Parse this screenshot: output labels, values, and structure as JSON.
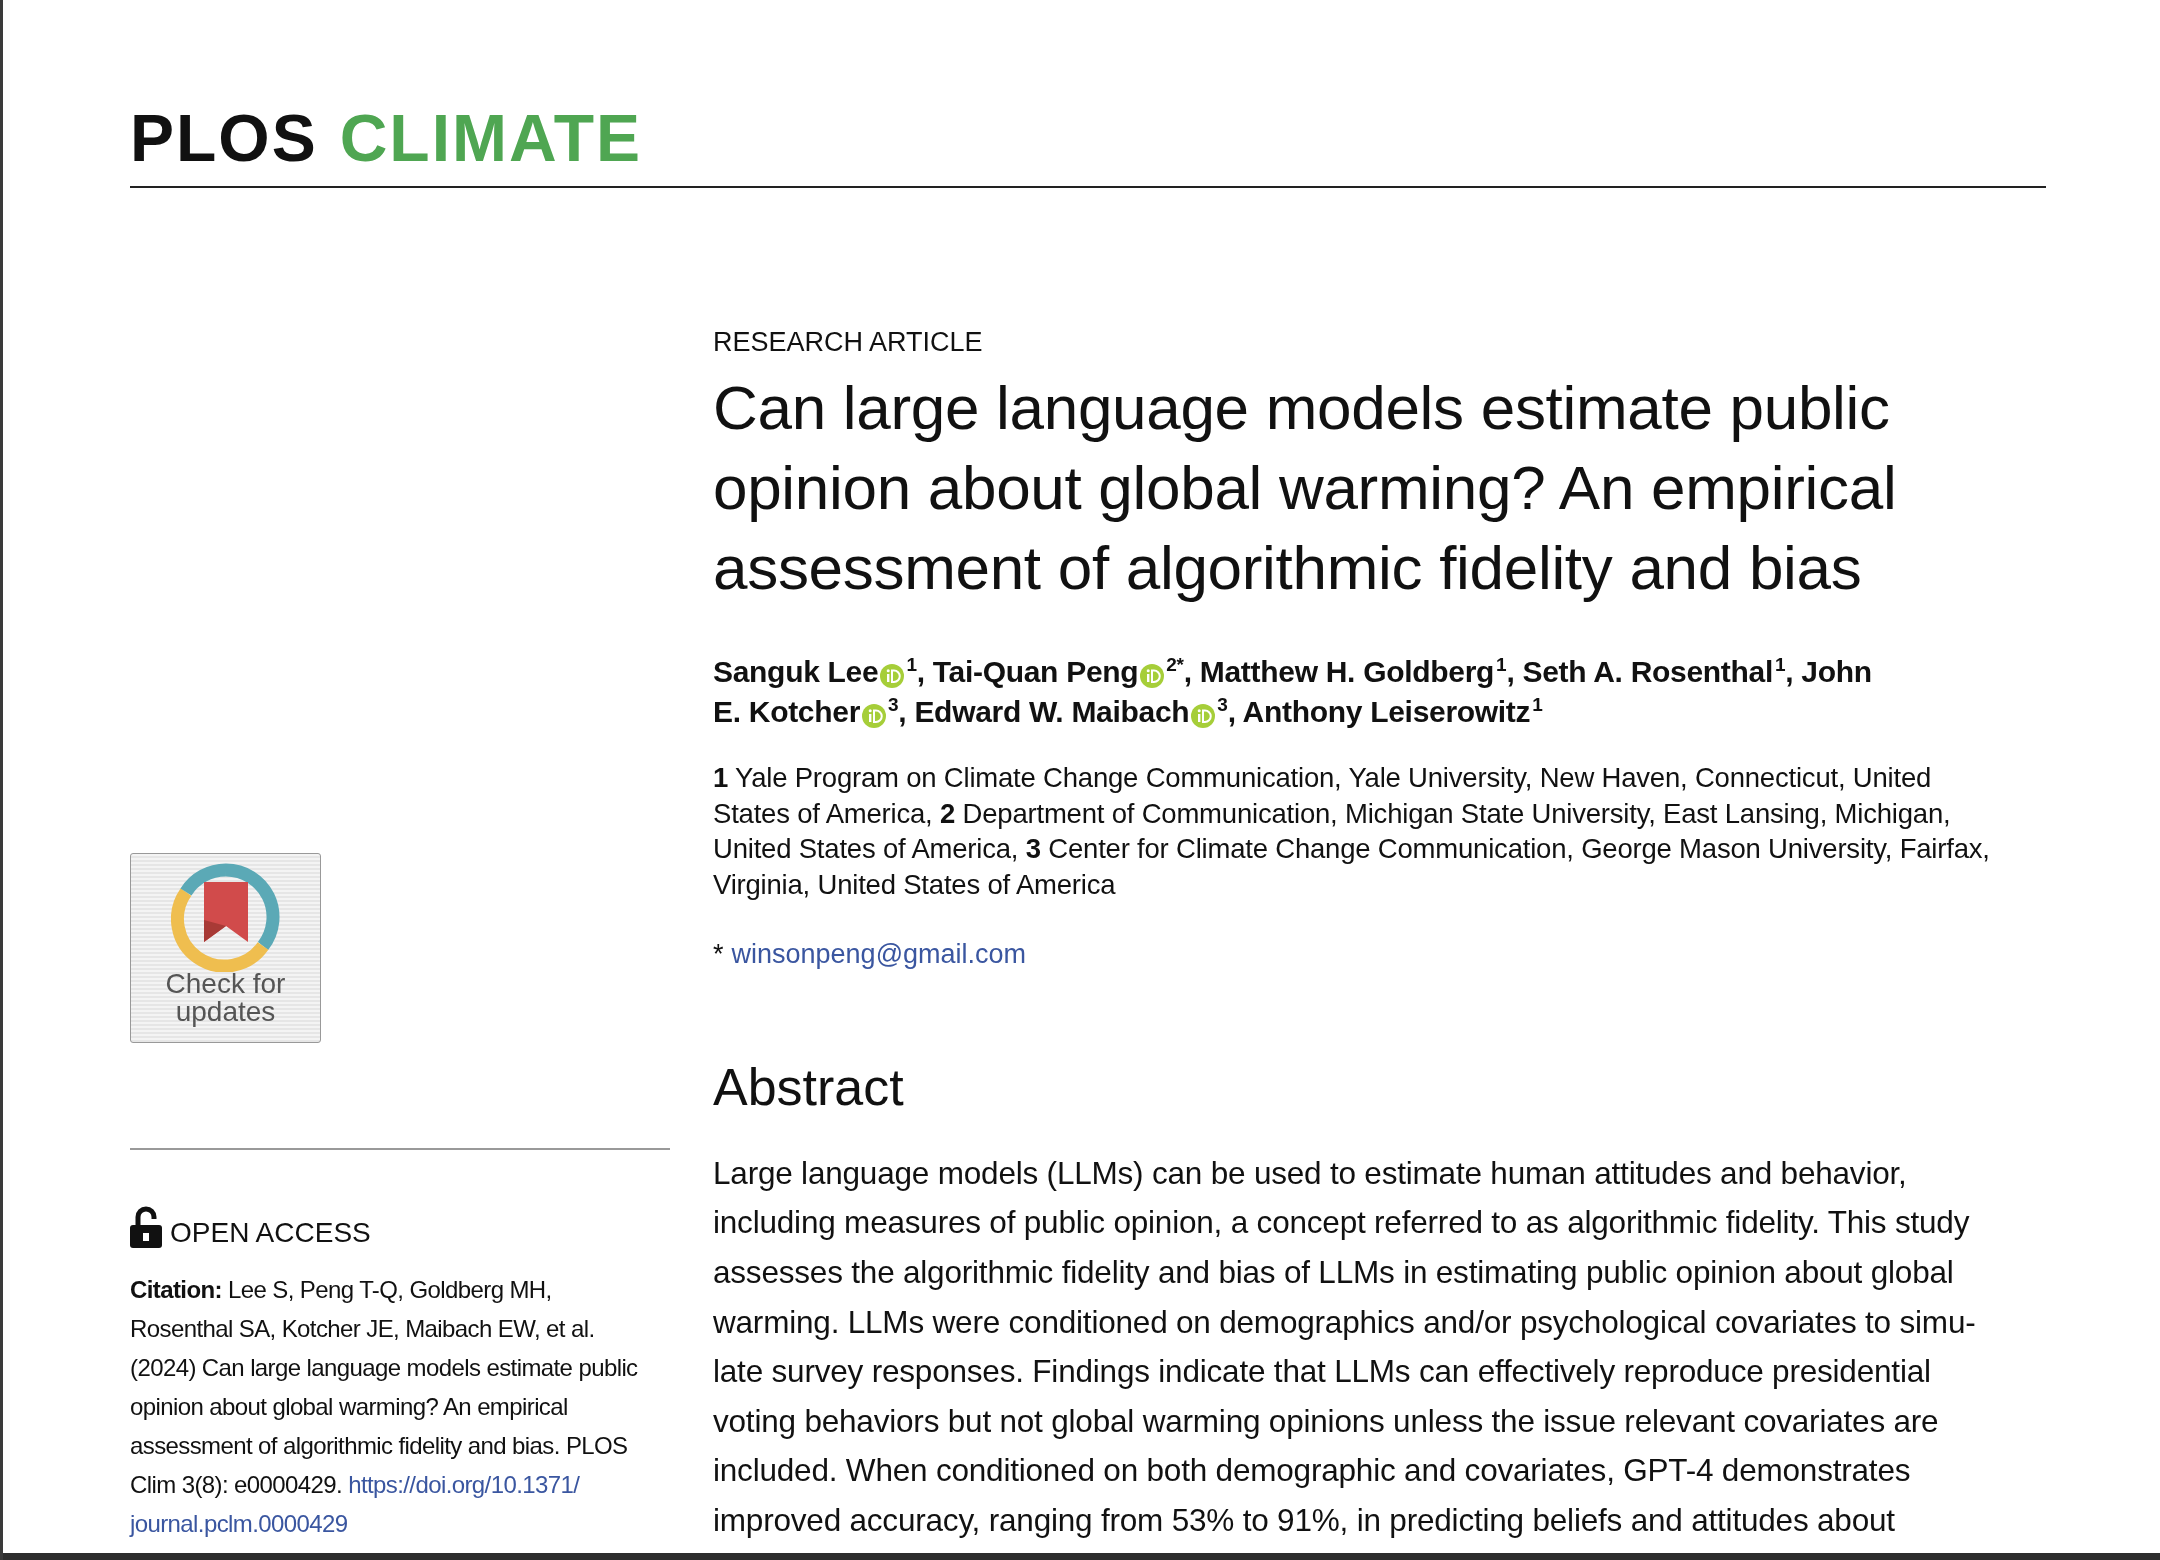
{
  "logo": {
    "parts": [
      {
        "text": "PLOS",
        "color": "#111111"
      },
      {
        "text": "CLIMATE",
        "color": "#4fa652"
      }
    ]
  },
  "sidebar": {
    "badge": {
      "label_lines": [
        "Check for",
        "updates"
      ]
    },
    "access": {
      "label": "OPEN ACCESS"
    },
    "citation": {
      "label": "Citation:",
      "text_lines": [
        " Lee S, Peng T-Q, Goldberg MH,",
        "Rosenthal SA, Kotcher JE, Maibach EW, et al.",
        "(2024) Can large language models estimate public",
        "opinion about global warming? An empirical",
        "assessment of algorithmic fidelity and bias. PLOS",
        "Clim 3(8): e0000429. "
      ],
      "link_lines": [
        "https://doi.org/10.1371/",
        "journal.pclm.0000429"
      ]
    }
  },
  "article": {
    "type": "RESEARCH ARTICLE",
    "title_lines": [
      "Can large language models estimate public",
      "opinion about global warming? An empirical",
      "assessment of algorithmic fidelity and bias"
    ],
    "authors": [
      {
        "name_lines": [
          "Sanguk Lee"
        ],
        "orcid": true,
        "refs": "1",
        "sep": ","
      },
      {
        "name_lines": [
          "Tai-Quan Peng"
        ],
        "orcid": true,
        "refs": "2*",
        "sep": ","
      },
      {
        "name_lines": [
          "Matthew H. Goldberg"
        ],
        "orcid": false,
        "refs": "1",
        "sep": ","
      },
      {
        "name_lines": [
          "Seth A. Rosenthal"
        ],
        "orcid": false,
        "refs": "1",
        "sep": ","
      },
      {
        "name_lines": [
          "John",
          "E. Kotcher"
        ],
        "orcid": true,
        "refs": "3",
        "sep": ","
      },
      {
        "name_lines": [
          "Edward W. Maibach"
        ],
        "orcid": true,
        "refs": "3",
        "sep": ","
      },
      {
        "name_lines": [
          "Anthony Leiserowitz"
        ],
        "orcid": false,
        "refs": "1"
      }
    ],
    "affiliation_lines": [
      "**1**  Yale Program on Climate Change Communication, Yale University, New Haven, Connecticut, United",
      "States of America, **2**  Department of Communication, Michigan State University, East Lansing, Michigan,",
      "United States of America, **3**  Center for Climate Change Communication, George Mason University, Fairfax,",
      "Virginia, United States of America"
    ],
    "correspondence": {
      "mark": "*",
      "email": "winsonpeng@gmail.com"
    },
    "abstract": {
      "heading": "Abstract",
      "lines": [
        "Large language models (LLMs) can be used to estimate human attitudes and behavior,",
        "including measures of public opinion, a concept referred to as algorithmic fidelity. This study",
        "assesses the algorithmic fidelity and bias of LLMs in estimating public opinion about global",
        "warming. LLMs were conditioned on demographics and/or psychological covariates to simu-",
        "late survey responses. Findings indicate that LLMs can effectively reproduce presidential",
        "voting behaviors but not global warming opinions unless the issue relevant covariates are",
        "included. When conditioned on both demographic and covariates, GPT-4 demonstrates",
        "improved accuracy, ranging from 53% to 91%, in predicting beliefs and attitudes about"
      ]
    }
  }
}
